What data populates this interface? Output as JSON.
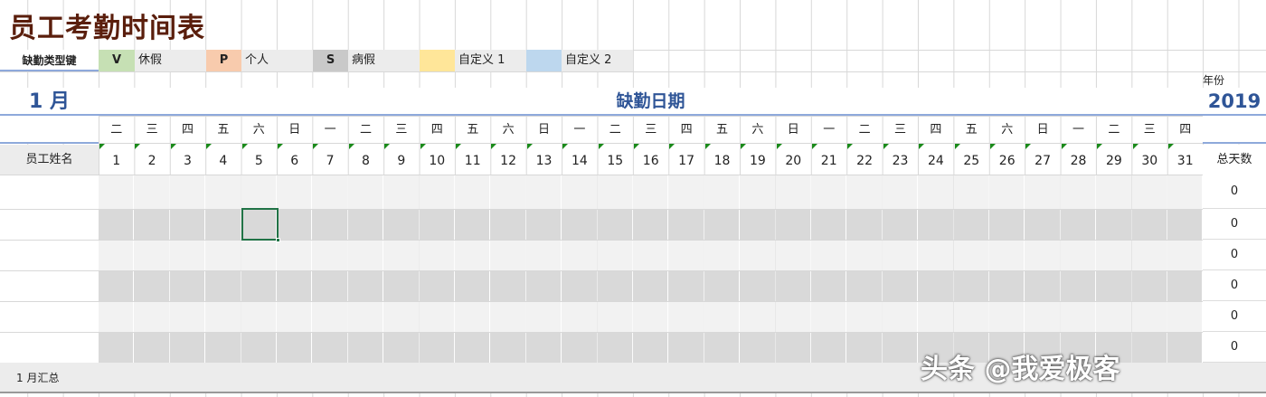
{
  "title": "员工考勤时间表",
  "legend": {
    "label": "缺勤类型键",
    "items": [
      {
        "code": "V",
        "name": "休假",
        "color": "#c6e0b4"
      },
      {
        "code": "P",
        "name": "个人",
        "color": "#f8cbad"
      },
      {
        "code": "S",
        "name": "病假",
        "color": "#c9c9c9"
      },
      {
        "code": "",
        "name": "自定义 1",
        "color": "#ffe699"
      },
      {
        "code": "",
        "name": "自定义 2",
        "color": "#bdd7ee"
      }
    ]
  },
  "month": "1 月",
  "section_title": "缺勤日期",
  "year_label": "年份",
  "year": "2019",
  "weekdays": [
    "二",
    "三",
    "四",
    "五",
    "六",
    "日",
    "一",
    "二",
    "三",
    "四",
    "五",
    "六",
    "日",
    "一",
    "二",
    "三",
    "四",
    "五",
    "六",
    "日",
    "一",
    "二",
    "三",
    "四",
    "五",
    "六",
    "日",
    "一",
    "二",
    "三",
    "四"
  ],
  "days": [
    "1",
    "2",
    "3",
    "4",
    "5",
    "6",
    "7",
    "8",
    "9",
    "10",
    "11",
    "12",
    "13",
    "14",
    "15",
    "16",
    "17",
    "18",
    "19",
    "20",
    "21",
    "22",
    "23",
    "24",
    "25",
    "26",
    "27",
    "28",
    "29",
    "30",
    "31"
  ],
  "employee_header": "员工姓名",
  "total_header": "总天数",
  "totals": [
    "0",
    "0",
    "0",
    "0",
    "0",
    "0"
  ],
  "summary_label": "1 月汇总",
  "watermark": "头条 @我爱极客"
}
